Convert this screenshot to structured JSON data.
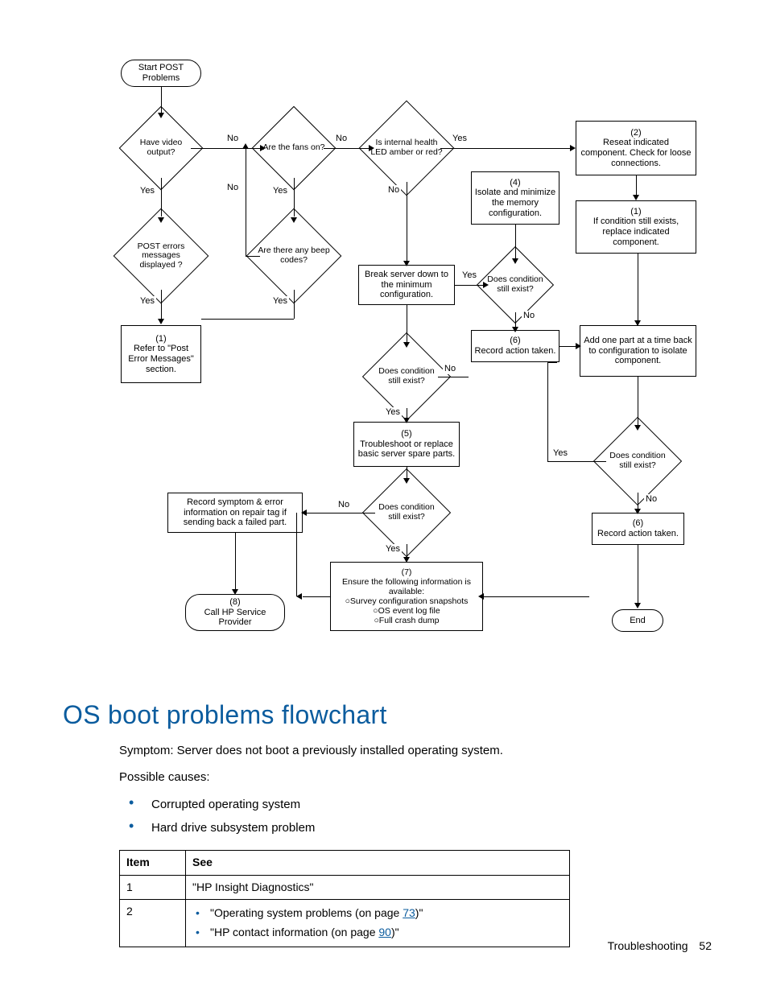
{
  "flow": {
    "start": "Start POST Problems",
    "d_video": "Have video output?",
    "d_fans": "Are the fans on?",
    "d_led": "Is internal health LED amber or red?",
    "p_reseat": "(2)\nReseat indicated component. Check for loose connections.",
    "p_isolate": "(4)\nIsolate and minimize the memory configuration.",
    "p_replace": "(1)\nIf condition still exists, replace indicated component.",
    "d_post_err": "POST errors messages displayed ?",
    "d_beep": "Are there any beep codes?",
    "p_break": "Break server down to the minimum configuration.",
    "d_cond_r1": "Does condition still exist?",
    "p_record_r": "(6)\nRecord action taken.",
    "p_addone": "Add one part at a time back to configuration to isolate component.",
    "d_cond_r2": "Does condition still exist?",
    "p_refer": "(1)\nRefer to \"Post Error Messages\" section.",
    "d_cond_c1": "Does condition still exist?",
    "p_trouble": "(5)\nTroubleshoot or replace basic server spare parts.",
    "d_cond_c2": "Does condition still exist?",
    "p_record_sym": "Record symptom & error information on repair tag if sending back a failed part.",
    "p_ensure": "(7)\nEnsure the following information is available:\n○Survey configuration snapshots\n○OS event log file\n○Full crash dump",
    "p_record_r2": "(6)\nRecord action taken.",
    "t_call": "(8)\nCall HP Service Provider",
    "t_end": "End",
    "yes": "Yes",
    "no": "No"
  },
  "section_title": "OS boot problems flowchart",
  "symptom": "Symptom: Server does not boot a previously installed operating system.",
  "possible_causes_label": "Possible causes:",
  "causes": {
    "c0": "Corrupted operating system",
    "c1": "Hard drive subsystem problem"
  },
  "table": {
    "h_item": "Item",
    "h_see": "See",
    "r1_item": "1",
    "r1_text": "\"HP Insight Diagnostics\"",
    "r2_item": "2",
    "r2_a_pre": "\"Operating system problems (on page ",
    "r2_a_link": "73",
    "r2_a_post": ")\"",
    "r2_b_pre": "\"HP contact information (on page ",
    "r2_b_link": "90",
    "r2_b_post": ")\""
  },
  "footer": {
    "section": "Troubleshooting",
    "page": "52"
  }
}
